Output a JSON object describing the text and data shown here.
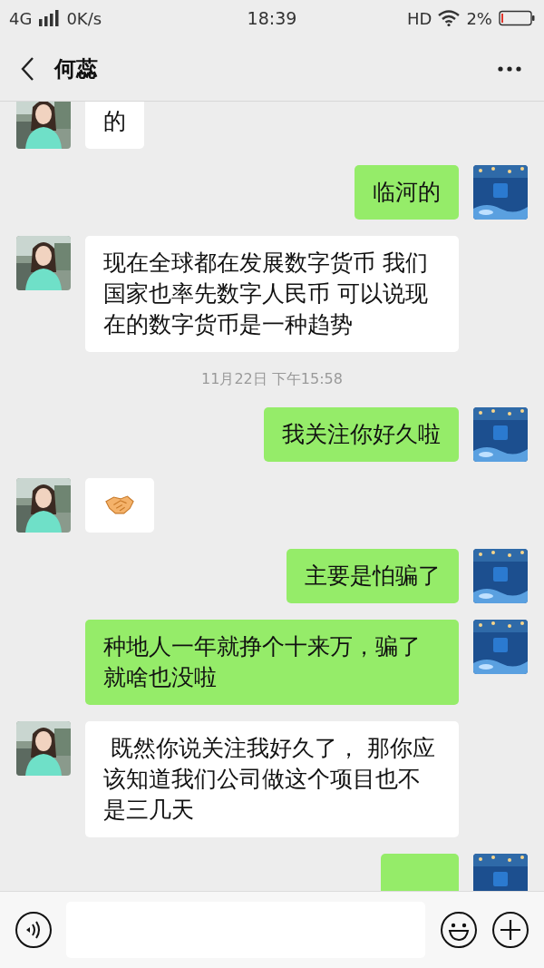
{
  "status_bar": {
    "network": "4G",
    "speed": "0K/s",
    "time": "18:39",
    "hd": "HD",
    "battery": "2%"
  },
  "header": {
    "title": "何蕊"
  },
  "messages": [
    {
      "mine": false,
      "kind": "text",
      "text": "的"
    },
    {
      "mine": true,
      "kind": "text",
      "text": "临河的"
    },
    {
      "mine": false,
      "kind": "text",
      "text": "现在全球都在发展数字货币 我们国家也率先数字人民币 可以说现在的数字货币是一种趋势"
    },
    {
      "kind": "time",
      "text": "11月22日 下午15:58"
    },
    {
      "mine": true,
      "kind": "text",
      "text": "我关注你好久啦"
    },
    {
      "mine": false,
      "kind": "emoji"
    },
    {
      "mine": true,
      "kind": "text",
      "text": "主要是怕骗了"
    },
    {
      "mine": true,
      "kind": "text",
      "text": "种地人一年就挣个十来万，骗了就啥也没啦"
    },
    {
      "mine": false,
      "kind": "text",
      "text": " 既然你说关注我好久了， 那你应该知道我们公司做这个项目也不是三几天"
    },
    {
      "mine": true,
      "kind": "cut"
    }
  ]
}
